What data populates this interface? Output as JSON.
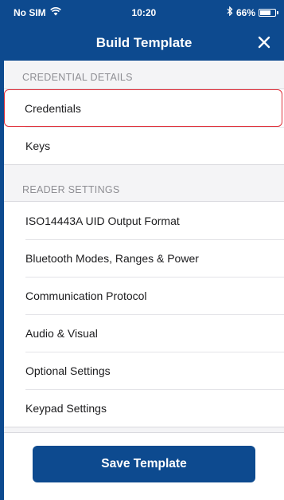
{
  "status_bar": {
    "carrier": "No SIM",
    "time": "10:20",
    "battery": "66%",
    "battery_level": 0.66,
    "wifi_icon": "wifi-icon",
    "bluetooth_icon": "bluetooth-icon"
  },
  "nav": {
    "title": "Build Template",
    "close_icon": "close-icon"
  },
  "sections": {
    "credential_details": {
      "header": "CREDENTIAL DETAILS",
      "items": [
        {
          "label": "Credentials",
          "selected": true
        },
        {
          "label": "Keys",
          "selected": false
        }
      ]
    },
    "reader_settings": {
      "header": "READER SETTINGS",
      "items": [
        {
          "label": "ISO14443A UID Output Format"
        },
        {
          "label": "Bluetooth Modes, Ranges & Power"
        },
        {
          "label": "Communication Protocol"
        },
        {
          "label": "Audio & Visual"
        },
        {
          "label": "Optional Settings"
        },
        {
          "label": "Keypad Settings"
        }
      ]
    }
  },
  "footer": {
    "save_label": "Save Template"
  },
  "colors": {
    "brand": "#0d4a8f",
    "highlight": "#e0303a"
  }
}
